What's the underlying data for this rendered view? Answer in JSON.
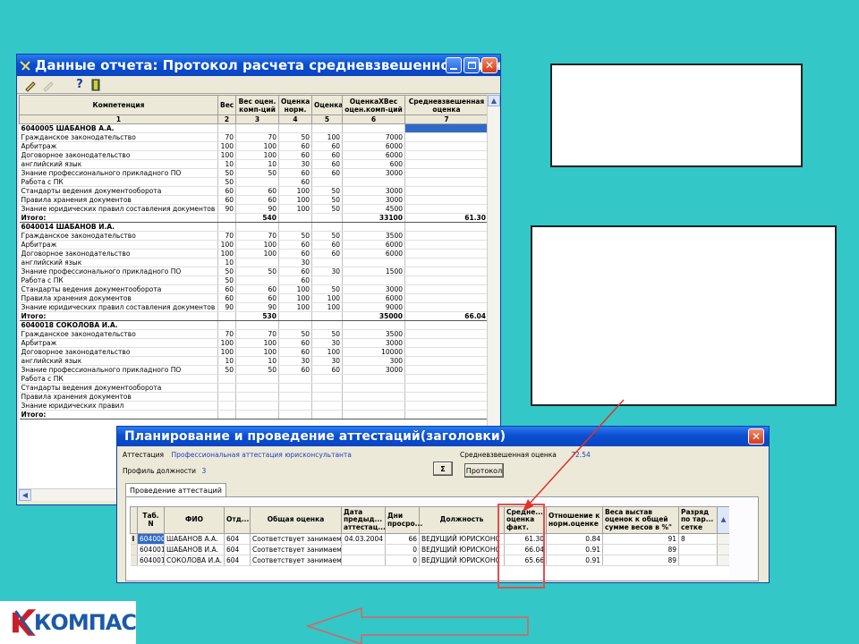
{
  "report_window": {
    "title": "Данные отчета:  Протокол расчета средневзвешенной оценки ...",
    "columns": [
      {
        "label": "Компетенция",
        "num": "1"
      },
      {
        "label": "Вес",
        "num": "2"
      },
      {
        "label": "Вес оцен. комп-ций",
        "num": "3"
      },
      {
        "label": "Оценка норм.",
        "num": "4"
      },
      {
        "label": "Оценка",
        "num": "5"
      },
      {
        "label": "ОценкаXВес оцен.комп-ций",
        "num": "6"
      },
      {
        "label": "Средневзвешенная оценка",
        "num": "7"
      }
    ],
    "rows": [
      {
        "kind": "grp",
        "cells": [
          "6040005 ШАБАНОВ А.А.",
          "",
          "",
          "",
          "",
          "",
          ""
        ]
      },
      {
        "kind": "row",
        "cells": [
          "Гражданское законодательство",
          "70",
          "70",
          "50",
          "100",
          "7000",
          ""
        ]
      },
      {
        "kind": "row",
        "cells": [
          "Арбитраж",
          "100",
          "100",
          "60",
          "60",
          "6000",
          ""
        ]
      },
      {
        "kind": "row",
        "cells": [
          "Договорное законодательство",
          "100",
          "100",
          "60",
          "60",
          "6000",
          ""
        ]
      },
      {
        "kind": "row",
        "cells": [
          "английский язык",
          "10",
          "10",
          "30",
          "60",
          "600",
          ""
        ]
      },
      {
        "kind": "row",
        "cells": [
          "Знание профессионального прикладного ПО",
          "50",
          "50",
          "60",
          "60",
          "3000",
          ""
        ]
      },
      {
        "kind": "row",
        "cells": [
          "Работа с ПК",
          "50",
          "",
          "60",
          "",
          "",
          ""
        ]
      },
      {
        "kind": "row",
        "cells": [
          "Стандарты ведения документооборота",
          "60",
          "60",
          "100",
          "50",
          "3000",
          ""
        ]
      },
      {
        "kind": "row",
        "cells": [
          "Правила хранения документов",
          "60",
          "60",
          "100",
          "50",
          "3000",
          ""
        ]
      },
      {
        "kind": "row",
        "cells": [
          "Знание юридических правил составления документов",
          "90",
          "90",
          "100",
          "50",
          "4500",
          ""
        ]
      },
      {
        "kind": "tot",
        "cells": [
          "Итого:",
          "",
          "540",
          "",
          "",
          "33100",
          "61.30"
        ]
      },
      {
        "kind": "grp",
        "cells": [
          "6040014 ШАБАНОВ И.А.",
          "",
          "",
          "",
          "",
          "",
          ""
        ]
      },
      {
        "kind": "row",
        "cells": [
          "Гражданское законодательство",
          "70",
          "70",
          "50",
          "50",
          "3500",
          ""
        ]
      },
      {
        "kind": "row",
        "cells": [
          "Арбитраж",
          "100",
          "100",
          "60",
          "60",
          "6000",
          ""
        ]
      },
      {
        "kind": "row",
        "cells": [
          "Договорное законодательство",
          "100",
          "100",
          "60",
          "60",
          "6000",
          ""
        ]
      },
      {
        "kind": "row",
        "cells": [
          "английский язык",
          "10",
          "",
          "30",
          "",
          "",
          ""
        ]
      },
      {
        "kind": "row",
        "cells": [
          "Знание профессионального прикладного ПО",
          "50",
          "50",
          "60",
          "30",
          "1500",
          ""
        ]
      },
      {
        "kind": "row",
        "cells": [
          "Работа с ПК",
          "50",
          "",
          "60",
          "",
          "",
          ""
        ]
      },
      {
        "kind": "row",
        "cells": [
          "Стандарты ведения документооборота",
          "60",
          "60",
          "100",
          "50",
          "3000",
          ""
        ]
      },
      {
        "kind": "row",
        "cells": [
          "Правила хранения документов",
          "60",
          "60",
          "100",
          "100",
          "6000",
          ""
        ]
      },
      {
        "kind": "row",
        "cells": [
          "Знание юридических правил составления документов",
          "90",
          "90",
          "100",
          "100",
          "9000",
          ""
        ]
      },
      {
        "kind": "tot",
        "cells": [
          "Итого:",
          "",
          "530",
          "",
          "",
          "35000",
          "66.04"
        ]
      },
      {
        "kind": "grp",
        "cells": [
          "6040018 СОКОЛОВА И.А.",
          "",
          "",
          "",
          "",
          "",
          ""
        ]
      },
      {
        "kind": "row",
        "cells": [
          "Гражданское законодательство",
          "70",
          "70",
          "50",
          "50",
          "3500",
          ""
        ]
      },
      {
        "kind": "row",
        "cells": [
          "Арбитраж",
          "100",
          "100",
          "60",
          "30",
          "3000",
          ""
        ]
      },
      {
        "kind": "row",
        "cells": [
          "Договорное законодательство",
          "100",
          "100",
          "60",
          "100",
          "10000",
          ""
        ]
      },
      {
        "kind": "row",
        "cells": [
          "английский язык",
          "10",
          "10",
          "30",
          "30",
          "300",
          ""
        ]
      },
      {
        "kind": "row",
        "cells": [
          "Знание профессионального прикладного ПО",
          "50",
          "50",
          "60",
          "60",
          "3000",
          ""
        ]
      },
      {
        "kind": "row",
        "cells": [
          "Работа с ПК",
          "",
          "",
          "",
          "",
          "",
          ""
        ]
      },
      {
        "kind": "row",
        "cells": [
          "Стандарты ведения документооборота",
          "",
          "",
          "",
          "",
          "",
          ""
        ]
      },
      {
        "kind": "row",
        "cells": [
          "Правила хранения документов",
          "",
          "",
          "",
          "",
          "",
          ""
        ]
      },
      {
        "kind": "row",
        "cells": [
          "Знание юридических правил",
          "",
          "",
          "",
          "",
          "",
          ""
        ]
      },
      {
        "kind": "tot",
        "cells": [
          "Итого:",
          "",
          "",
          "",
          "",
          "",
          ""
        ]
      }
    ]
  },
  "attest_window": {
    "title": "Планирование и проведение аттестаций(заголовки)",
    "attestation_label": "Аттестация",
    "attestation_value": "Профессиональная аттестация юрисконсультанта",
    "avg_label": "Средневзвешенная оценка",
    "avg_value": "72.54",
    "profile_label": "Профиль должности",
    "profile_value": "3",
    "sigma_label": "Σ",
    "protocol_button": "Протокол",
    "tab_label": "Проведение аттестаций",
    "columns": [
      "Таб. N",
      "ФИО",
      "Отд...",
      "Общая оценка",
      "Дата предыд... аттестац...",
      "Дни просро...",
      "Должность",
      "Средне... оценка факт.",
      "Отношение к норм.оценке",
      "Веса выстав оценок к общей сумме весов в %\"",
      "Разряд по тар... сетке"
    ],
    "rows": [
      [
        "6040005",
        "ШАБАНОВ А.А.",
        "604",
        "Соответствует занимаемо",
        "04.03.2004",
        "66",
        "ВЕДУЩИЙ ЮРИСКОНС",
        "61.30",
        "0.84",
        "91",
        "8"
      ],
      [
        "6040014",
        "ШАБАНОВ И.А.",
        "604",
        "Соответствует занимаемо",
        "",
        "0",
        "ВЕДУЩИЙ ЮРИСКОНС",
        "66.04",
        "0.91",
        "89",
        ""
      ],
      [
        "6040018",
        "СОКОЛОВА И.А.",
        "604",
        "Соответствует занимаемо",
        "",
        "0",
        "ВЕДУЩИЙ ЮРИСКОНС",
        "65.66",
        "0.91",
        "89",
        ""
      ]
    ]
  },
  "logo": {
    "text": "КОМПАС"
  },
  "colors": {
    "background": "#33c7c7",
    "titlebar": "#0b4fd0",
    "highlight": "#e05050",
    "selection": "#316ac5"
  }
}
